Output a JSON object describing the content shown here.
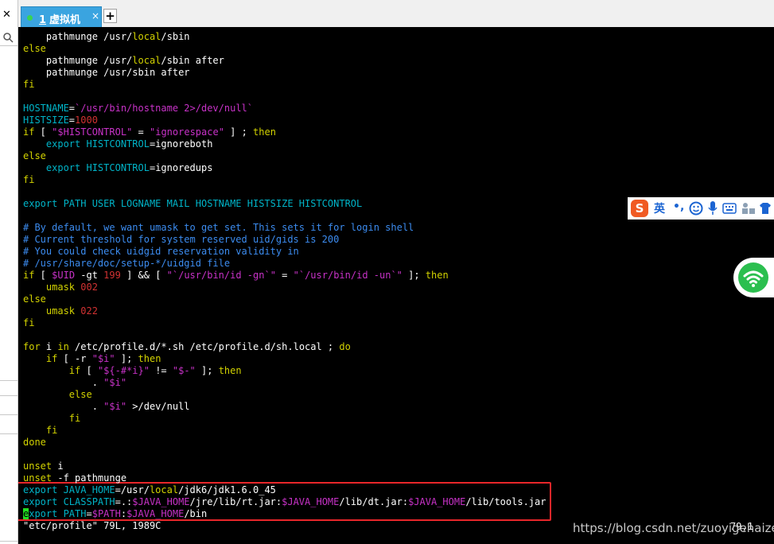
{
  "window": {
    "close_glyph": "✕",
    "tab": {
      "number": "1",
      "label": "虚拟机",
      "close_glyph": "×"
    },
    "add_tab_glyph": "+"
  },
  "terminal": {
    "lines": [
      [
        [
          "    pathmunge /usr/",
          "w"
        ],
        [
          "local",
          "kw"
        ],
        [
          "/sbin",
          "w"
        ]
      ],
      [
        [
          "else",
          "kw"
        ]
      ],
      [
        [
          "    pathmunge /usr/",
          "w"
        ],
        [
          "local",
          "kw"
        ],
        [
          "/sbin after",
          "w"
        ]
      ],
      [
        [
          "    pathmunge /usr/sbin after",
          "w"
        ]
      ],
      [
        [
          "fi",
          "kw"
        ]
      ],
      [
        [
          "",
          "w"
        ]
      ],
      [
        [
          "HOSTNAME",
          "cy"
        ],
        [
          "=",
          "w"
        ],
        [
          "`/usr/bin/hostname 2>/dev/null`",
          "st"
        ]
      ],
      [
        [
          "HISTSIZE",
          "cy"
        ],
        [
          "=",
          "w"
        ],
        [
          "1000",
          "nm"
        ]
      ],
      [
        [
          "if",
          "kw"
        ],
        [
          " [ ",
          "w"
        ],
        [
          "\"",
          "st"
        ],
        [
          "$HISTCONTROL",
          "st"
        ],
        [
          "\"",
          "st"
        ],
        [
          " = ",
          "w"
        ],
        [
          "\"ignorespace\"",
          "st"
        ],
        [
          " ] ; ",
          "w"
        ],
        [
          "then",
          "kw"
        ]
      ],
      [
        [
          "    export HISTCONTROL",
          "cy"
        ],
        [
          "=",
          "w"
        ],
        [
          "ignoreboth",
          "w"
        ]
      ],
      [
        [
          "else",
          "kw"
        ]
      ],
      [
        [
          "    export HISTCONTROL",
          "cy"
        ],
        [
          "=",
          "w"
        ],
        [
          "ignoredups",
          "w"
        ]
      ],
      [
        [
          "fi",
          "kw"
        ]
      ],
      [
        [
          "",
          "w"
        ]
      ],
      [
        [
          "export PATH USER LOGNAME MAIL HOSTNAME HISTSIZE HISTCONTROL",
          "cy"
        ]
      ],
      [
        [
          "",
          "w"
        ]
      ],
      [
        [
          "# By default, we want umask to get set. This sets it for login shell",
          "cm"
        ]
      ],
      [
        [
          "# Current threshold for system reserved uid/gids is 200",
          "cm"
        ]
      ],
      [
        [
          "# You could check uidgid reservation validity in",
          "cm"
        ]
      ],
      [
        [
          "# /usr/share/doc/setup-*/uidgid file",
          "cm"
        ]
      ],
      [
        [
          "if",
          "kw"
        ],
        [
          " [ ",
          "w"
        ],
        [
          "$UID",
          "st"
        ],
        [
          " -gt ",
          "w"
        ],
        [
          "199",
          "nm"
        ],
        [
          " ] && [ ",
          "w"
        ],
        [
          "\"`/usr/bin/id -gn`\"",
          "st"
        ],
        [
          " = ",
          "w"
        ],
        [
          "\"`/usr/bin/id -un`\"",
          "st"
        ],
        [
          " ]; ",
          "w"
        ],
        [
          "then",
          "kw"
        ]
      ],
      [
        [
          "    umask ",
          "kw"
        ],
        [
          "002",
          "nm"
        ]
      ],
      [
        [
          "else",
          "kw"
        ]
      ],
      [
        [
          "    umask ",
          "kw"
        ],
        [
          "022",
          "nm"
        ]
      ],
      [
        [
          "fi",
          "kw"
        ]
      ],
      [
        [
          "",
          "w"
        ]
      ],
      [
        [
          "for",
          "kw"
        ],
        [
          " i ",
          "w"
        ],
        [
          "in",
          "kw"
        ],
        [
          " /etc/profile.d/*.sh /etc/profile.d/sh.local ; ",
          "w"
        ],
        [
          "do",
          "kw"
        ]
      ],
      [
        [
          "    if",
          "kw"
        ],
        [
          " [ -r ",
          "w"
        ],
        [
          "\"$i\"",
          "st"
        ],
        [
          " ]; ",
          "w"
        ],
        [
          "then",
          "kw"
        ]
      ],
      [
        [
          "        if",
          "kw"
        ],
        [
          " [ ",
          "w"
        ],
        [
          "\"${-#*i}\"",
          "st"
        ],
        [
          " != ",
          "w"
        ],
        [
          "\"$-\"",
          "st"
        ],
        [
          " ]; ",
          "w"
        ],
        [
          "then",
          "kw"
        ]
      ],
      [
        [
          "            . ",
          "w"
        ],
        [
          "\"$i\"",
          "st"
        ]
      ],
      [
        [
          "        else",
          "kw"
        ]
      ],
      [
        [
          "            . ",
          "w"
        ],
        [
          "\"$i\"",
          "st"
        ],
        [
          " >/dev/null",
          "w"
        ]
      ],
      [
        [
          "        fi",
          "kw"
        ]
      ],
      [
        [
          "    fi",
          "kw"
        ]
      ],
      [
        [
          "done",
          "kw"
        ]
      ],
      [
        [
          "",
          "w"
        ]
      ],
      [
        [
          "unset",
          "kw"
        ],
        [
          " i",
          "w"
        ]
      ],
      [
        [
          "unset",
          "kw"
        ],
        [
          " -f pathmunge",
          "w"
        ]
      ],
      [
        [
          "export JAVA_HOME",
          "cy"
        ],
        [
          "=",
          "w"
        ],
        [
          "/usr/",
          "w"
        ],
        [
          "local",
          "kw"
        ],
        [
          "/jdk6/jdk1.6.0_45",
          "w"
        ]
      ],
      [
        [
          "export CLASSPATH",
          "cy"
        ],
        [
          "=",
          "w"
        ],
        [
          ".:",
          "w"
        ],
        [
          "$JAVA_HOME",
          "st"
        ],
        [
          "/jre/lib/rt.jar:",
          "w"
        ],
        [
          "$JAVA_HOME",
          "st"
        ],
        [
          "/lib/dt.jar:",
          "w"
        ],
        [
          "$JAVA_HOME",
          "st"
        ],
        [
          "/lib/tools.jar",
          "w"
        ]
      ],
      [
        [
          "e",
          "cursor"
        ],
        [
          "xport PATH",
          "cy"
        ],
        [
          "=",
          "w"
        ],
        [
          "$PATH",
          "st"
        ],
        [
          ":",
          "w"
        ],
        [
          "$JAVA_HOME",
          "st"
        ],
        [
          "/bin",
          "w"
        ]
      ],
      [
        [
          "\"etc/profile\" 79L, 1989C",
          "w"
        ]
      ]
    ],
    "cursor_position": "79,1"
  },
  "ime_toolbar": {
    "logo": "S",
    "mode": "英",
    "punct": "•,",
    "items": [
      "emoji-icon",
      "mic-icon",
      "keyboard-icon",
      "tools-icon",
      "skin-icon"
    ]
  },
  "watermark": "https://blog.csdn.net/zuoyigehaizei",
  "colors": {
    "keyword": "#d2d200",
    "variable": "#00b4c8",
    "string": "#c832c8",
    "number": "#d23232",
    "comment": "#3c8cf0",
    "highlight_box": "#e8262a",
    "tab": "#3aa4e0"
  }
}
